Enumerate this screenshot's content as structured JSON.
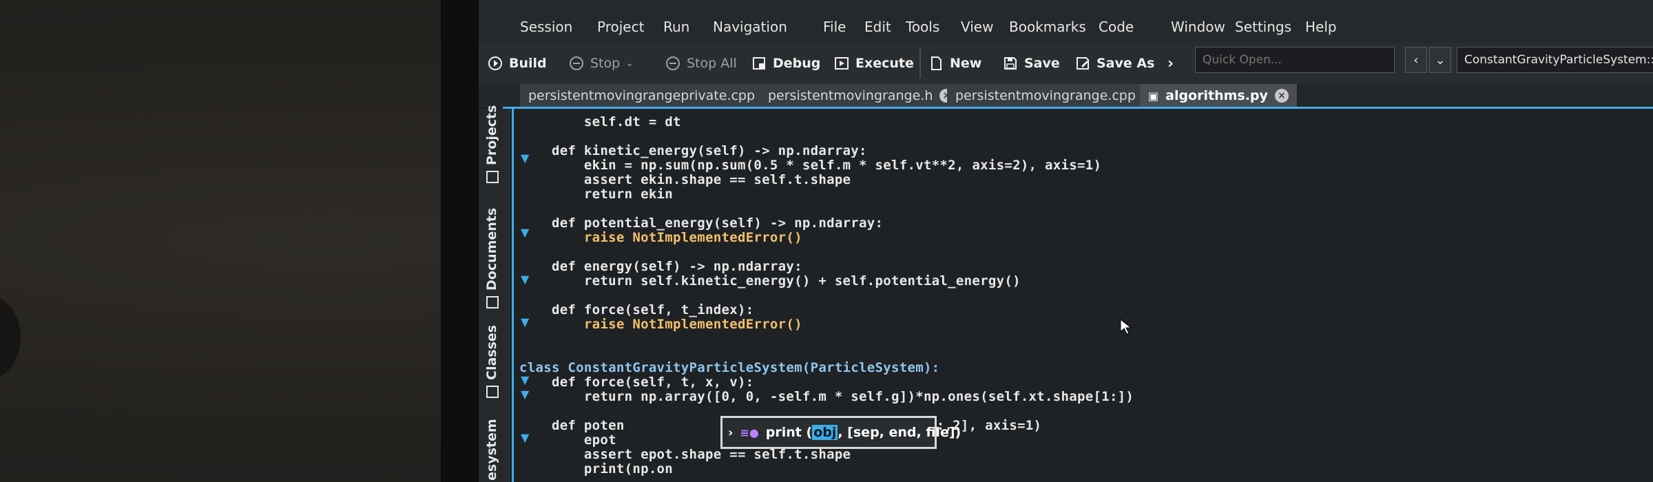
{
  "menubar": {
    "items": [
      "Session",
      "Project",
      "Run",
      "Navigation",
      "File",
      "Edit",
      "Tools",
      "View",
      "Bookmarks",
      "Code",
      "Window",
      "Settings",
      "Help"
    ]
  },
  "toolbar": {
    "build": "Build",
    "stop": "Stop",
    "stop_all": "Stop All",
    "debug": "Debug",
    "execute": "Execute",
    "new": "New",
    "save": "Save",
    "save_as": "Save As",
    "quick_open_placeholder": "Quick Open...",
    "context": "ConstantGravityParticleSystem::pot"
  },
  "tabs": [
    {
      "label": "persistentmovingrangeprivate.cpp",
      "active": false
    },
    {
      "label": "persistentmovingrange.h",
      "active": false
    },
    {
      "label": "persistentmovingrange.cpp",
      "active": false
    },
    {
      "label": "algorithms.py",
      "active": true
    }
  ],
  "dock": [
    "Projects",
    "Documents",
    "Classes",
    "esystem"
  ],
  "editor": {
    "lines": [
      "        self.dt = dt",
      "",
      "    def kinetic_energy(self) -> np.ndarray:",
      "        ekin = np.sum(np.sum(0.5 * self.m * self.vt**2, axis=2), axis=1)",
      "        assert ekin.shape == self.t.shape",
      "        return ekin",
      "",
      "    def potential_energy(self) -> np.ndarray:",
      "        raise NotImplementedError()",
      "",
      "    def energy(self) -> np.ndarray:",
      "        return self.kinetic_energy() + self.potential_energy()",
      "",
      "    def force(self, t_index):",
      "        raise NotImplementedError()",
      "",
      "",
      "class ConstantGravityParticleSystem(ParticleSystem):",
      "    def force(self, t, x, v):",
      "        return np.array([0, 0, -self.m * self.g])*np.ones(self.xt.shape[1:])",
      "",
      "    def poten",
      "        epot",
      "        assert epot.shape == self.t.shape",
      "        print(np.on"
    ],
    "line_fragment_right": "xt[:,:,2], axis=1)"
  },
  "completion_popup": {
    "text_prefix": "print (",
    "param": "obj",
    "text_suffix": ", [sep, end, file])"
  },
  "colors": {
    "accent": "#3daee9",
    "number": "#f67400",
    "error_class": "#f3c06a",
    "function": "#8ec7f0"
  }
}
